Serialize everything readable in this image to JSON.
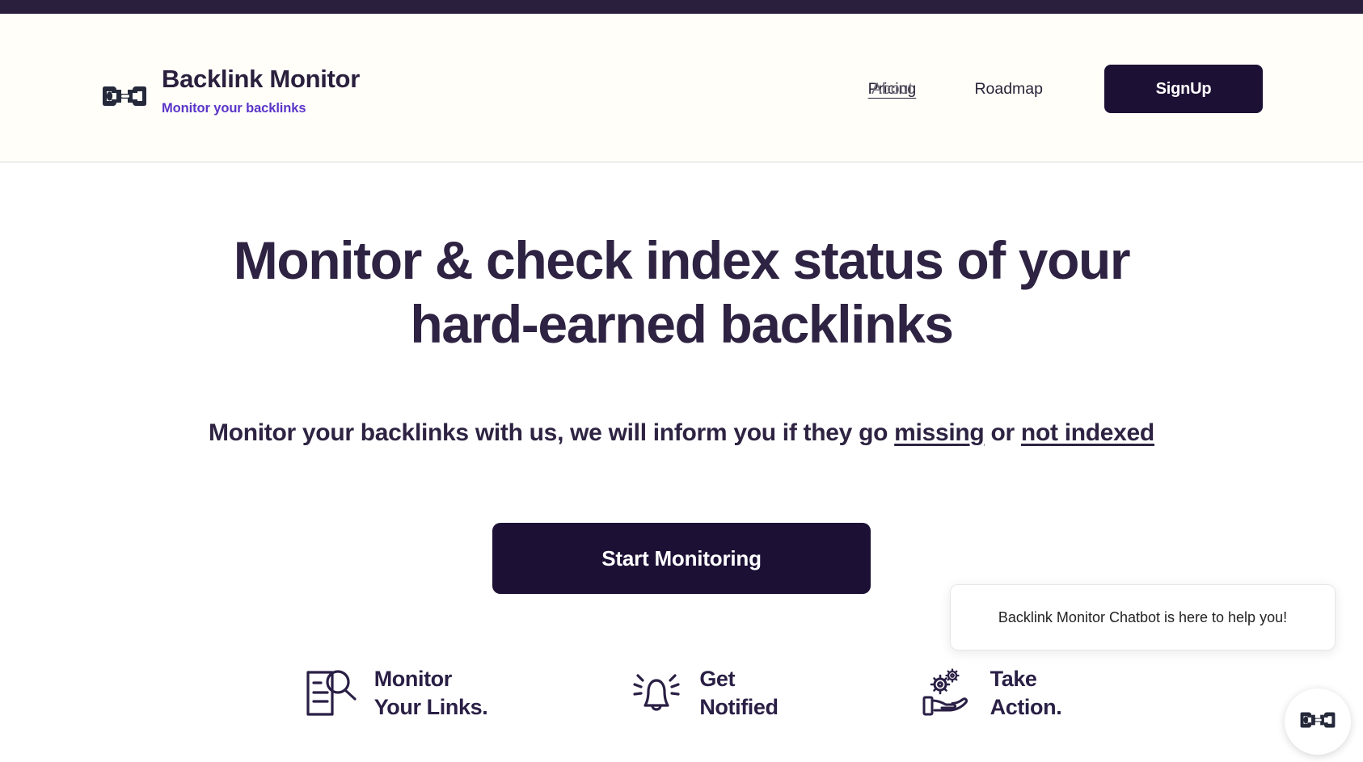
{
  "topbar": {
    "label": "accent-bar"
  },
  "header": {
    "logo_icon": "chain-link-icon",
    "brand_title": "Backlink Monitor",
    "brand_tagline": "Monitor your backlinks",
    "nav": {
      "pricing": "Pricing",
      "about": "About",
      "roadmap": "Roadmap",
      "signup": "SignUp"
    }
  },
  "hero": {
    "title_line1": "Monitor & check index status of your",
    "title_line2": "hard-earned backlinks",
    "sub_part1": "Monitor your backlinks with us, we will inform you if they go ",
    "sub_link1": "missing",
    "sub_part2": " or ",
    "sub_link2": "not indexed",
    "cta": "Start Monitoring"
  },
  "features": [
    {
      "icon": "document-search-icon",
      "label": "Monitor\nYour Links."
    },
    {
      "icon": "bell-ringing-icon",
      "label": "Get\nNotified"
    },
    {
      "icon": "hand-gears-icon",
      "label": "Take\nAction."
    }
  ],
  "chat": {
    "bubble_text": "Backlink Monitor Chatbot is here to help you!",
    "avatar_icon": "chain-link-icon"
  },
  "colors": {
    "topbar": "#2a1f3d",
    "header_bg": "#fffef9",
    "brand_dark": "#2a1f3d",
    "tagline_purple": "#5b35c9",
    "button_dark": "#1d1035",
    "heading": "#2e2342"
  }
}
